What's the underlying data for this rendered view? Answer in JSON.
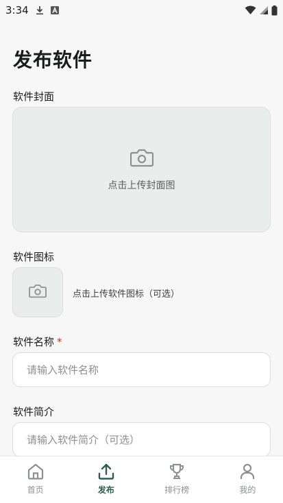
{
  "status_bar": {
    "time": "3:34",
    "icons": [
      "download-icon",
      "a-badge-icon",
      "wifi-icon",
      "cell-signal-icon",
      "battery-icon"
    ]
  },
  "page": {
    "title": "发布软件"
  },
  "cover": {
    "label": "软件封面",
    "hint": "点击上传封面图"
  },
  "app_icon": {
    "label": "软件图标",
    "hint": "点击上传软件图标（可选）"
  },
  "name_field": {
    "label": "软件名称",
    "required_mark": "*",
    "placeholder": "请输入软件名称"
  },
  "intro_field": {
    "label": "软件简介",
    "placeholder": "请输入软件简介（可选）"
  },
  "bottom_nav": {
    "items": [
      {
        "label": "首页",
        "icon": "home-icon",
        "active": false
      },
      {
        "label": "发布",
        "icon": "upload-icon",
        "active": true
      },
      {
        "label": "排行榜",
        "icon": "trophy-icon",
        "active": false
      },
      {
        "label": "我的",
        "icon": "person-icon",
        "active": false
      }
    ]
  },
  "colors": {
    "accent": "#2f5c4d",
    "required": "#d32f2f",
    "background": "#f6f7f6",
    "upload_box": "#e9edeb"
  }
}
